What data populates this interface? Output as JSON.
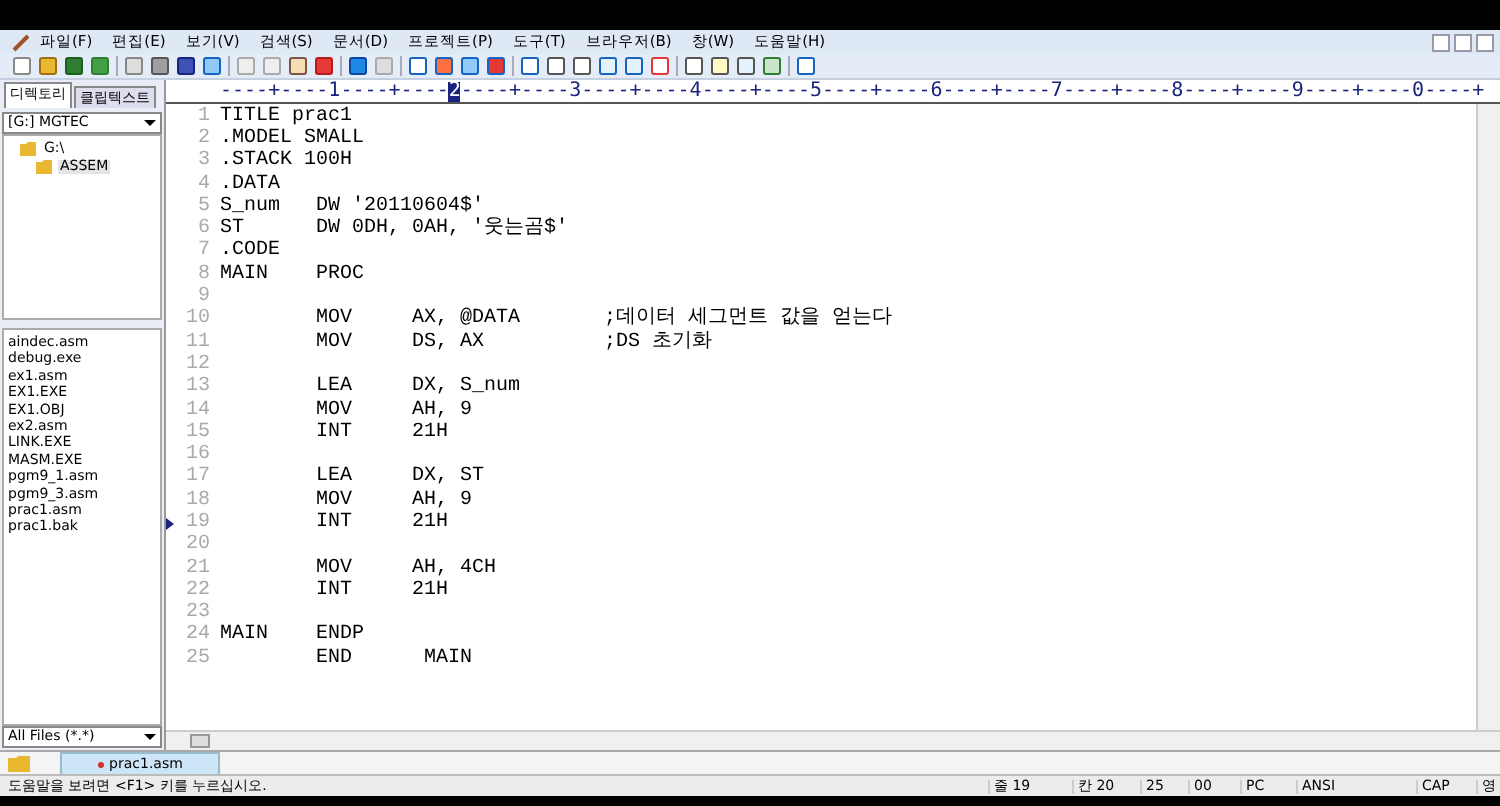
{
  "menu": [
    "파일(F)",
    "편집(E)",
    "보기(V)",
    "검색(S)",
    "문서(D)",
    "프로젝트(P)",
    "도구(T)",
    "브라우저(B)",
    "창(W)",
    "도움말(H)"
  ],
  "side_tabs": [
    {
      "label": "디렉토리",
      "selected": true
    },
    {
      "label": "클립텍스트",
      "selected": false
    }
  ],
  "drive": "[G:] MGTEC",
  "folders": [
    {
      "label": "G:\\",
      "selected": false,
      "children": [
        {
          "label": "ASSEM",
          "selected": true
        }
      ]
    }
  ],
  "files": [
    "aindec.asm",
    "debug.exe",
    "ex1.asm",
    "EX1.EXE",
    "EX1.OBJ",
    "ex2.asm",
    "LINK.EXE",
    "MASM.EXE",
    "pgm9_1.asm",
    "pgm9_3.asm",
    "prac1.asm",
    "prac1.bak"
  ],
  "filter": "All Files (*.*)",
  "ruler": [
    {
      "text": "----+----1----+----",
      "selected": false
    },
    {
      "text": "2",
      "selected": true
    },
    {
      "text": "----+----3----+----4----+----5----+----6----+----7----+----8----+----9----+----0----+",
      "selected": false
    }
  ],
  "lines": [
    {
      "num": "1",
      "text": "TITLE prac1",
      "current": false
    },
    {
      "num": "2",
      "text": ".MODEL SMALL",
      "current": false
    },
    {
      "num": "3",
      "text": ".STACK 100H",
      "current": false
    },
    {
      "num": "4",
      "text": ".DATA",
      "current": false
    },
    {
      "num": "5",
      "text": "S_num   DW '20110604$'",
      "current": false
    },
    {
      "num": "6",
      "text": "ST      DW 0DH, 0AH, '웃는곰$'",
      "current": false
    },
    {
      "num": "7",
      "text": ".CODE",
      "current": false
    },
    {
      "num": "8",
      "text": "MAIN    PROC",
      "current": false
    },
    {
      "num": "9",
      "current": false
    },
    {
      "num": "10",
      "text": "        MOV     AX, @DATA       ;데이터 세그먼트 값을 얻는다",
      "current": false
    },
    {
      "num": "11",
      "text": "        MOV     DS, AX          ;DS 초기화",
      "current": false
    },
    {
      "num": "12",
      "current": false
    },
    {
      "num": "13",
      "text": "        LEA     DX, S_num",
      "current": false
    },
    {
      "num": "14",
      "text": "        MOV     AH, 9",
      "current": false
    },
    {
      "num": "15",
      "text": "        INT     21H",
      "current": false
    },
    {
      "num": "16",
      "current": false
    },
    {
      "num": "17",
      "text": "        LEA     DX, ST",
      "current": false
    },
    {
      "num": "18",
      "text": "        MOV     AH, 9",
      "current": false
    },
    {
      "num": "19",
      "text": "        INT     21H",
      "current": true
    },
    {
      "num": "20",
      "current": false
    },
    {
      "num": "21",
      "text": "        MOV     AH, 4CH",
      "current": false
    },
    {
      "num": "22",
      "text": "        INT     21H",
      "current": false
    },
    {
      "num": "23",
      "current": false
    },
    {
      "num": "24",
      "text": "MAIN    ENDP",
      "current": false
    },
    {
      "num": "25",
      "text": "        END      MAIN",
      "current": false
    }
  ],
  "doc_tabs": [
    {
      "label": "prac1.asm",
      "selected": true
    }
  ],
  "status": {
    "message": "도움말을 보려면 <F1> 키를 누르십시오.",
    "cells": [
      "줄 19",
      "칸 20",
      "25",
      "00",
      "PC",
      "ANSI",
      "CAP",
      "영"
    ]
  }
}
